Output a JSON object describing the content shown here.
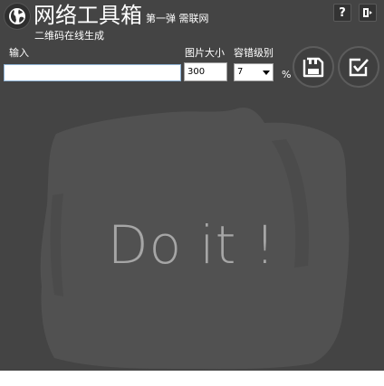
{
  "header": {
    "title": "网络工具箱",
    "subtitle": "第一弹 需联网",
    "description": "二维码在线生成",
    "globe_icon": "globe-icon",
    "help_label": "?",
    "exit_icon": "exit-icon"
  },
  "form": {
    "input_label": "输入",
    "input_value": "",
    "size_label": "图片大小",
    "size_value": "300",
    "tolerance_label": "容错级别",
    "tolerance_value": "7",
    "percent_suffix": "%",
    "save_icon": "save-icon",
    "confirm_icon": "checkbox-edit-icon"
  },
  "preview": {
    "placeholder_text": "Do it !"
  },
  "colors": {
    "background": "#444444",
    "text": "#ffffff",
    "placeholder": "#a6a6a6"
  }
}
